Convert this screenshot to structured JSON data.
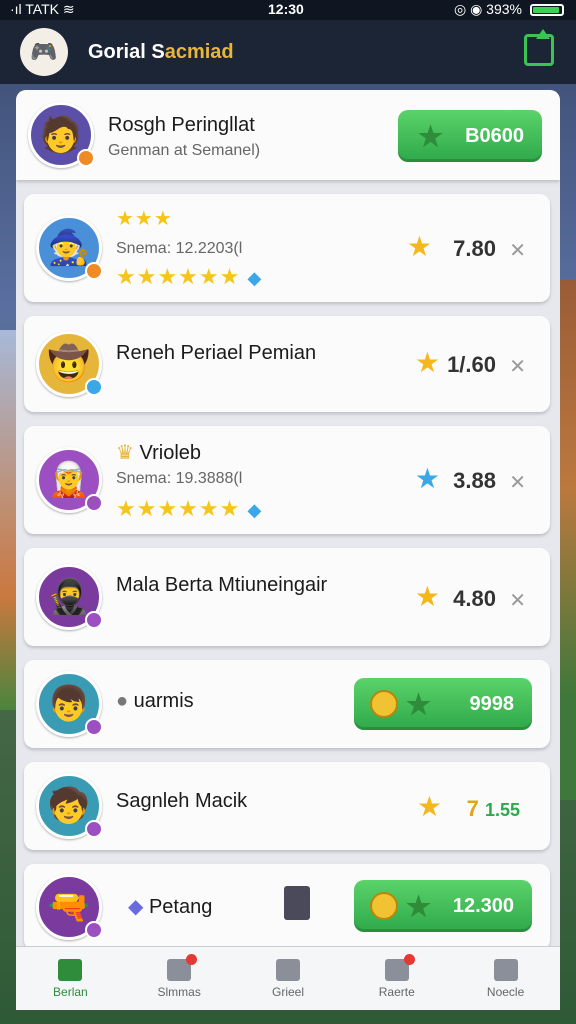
{
  "status_bar": {
    "left": "·ıl TATK ≋",
    "time": "12:30",
    "right": "◎ ◉ 393%"
  },
  "header": {
    "title_main": "Gorial S",
    "title_accent": "acmiad"
  },
  "rows": [
    {
      "name": "Rosgh Peringllat",
      "sub": "Genman at Semanel)",
      "button": "B0600"
    },
    {
      "name_badge": "★★★",
      "sub": "Snema: 12.2203(l",
      "stars": "★★★★★★",
      "score": "7.80"
    },
    {
      "name": "Reneh Periael Pemian",
      "score": "1/.60"
    },
    {
      "name": "Vrioleb",
      "sub": "Snema: 19.3888(l",
      "stars": "★★★★★★",
      "score": "3.88"
    },
    {
      "name": "Mala Berta Mtiuneingair",
      "score": "4.80"
    },
    {
      "name": "uarmis",
      "button": "9998"
    },
    {
      "name": "Sagnleh Macik",
      "score_a": "7",
      "score_b": "1.55"
    },
    {
      "name": "Petang",
      "button": "12.300"
    }
  ],
  "nav": [
    {
      "label": "Berlan",
      "icon": "home-icon"
    },
    {
      "label": "Slmmas",
      "icon": "chart-icon"
    },
    {
      "label": "Grieel",
      "icon": "document-icon"
    },
    {
      "label": "Raerte",
      "icon": "mail-icon"
    },
    {
      "label": "Noecle",
      "icon": "person-icon"
    }
  ],
  "colors": {
    "accent_green": "#2ea84a",
    "star": "#f5c518",
    "header": "#1c2536"
  }
}
